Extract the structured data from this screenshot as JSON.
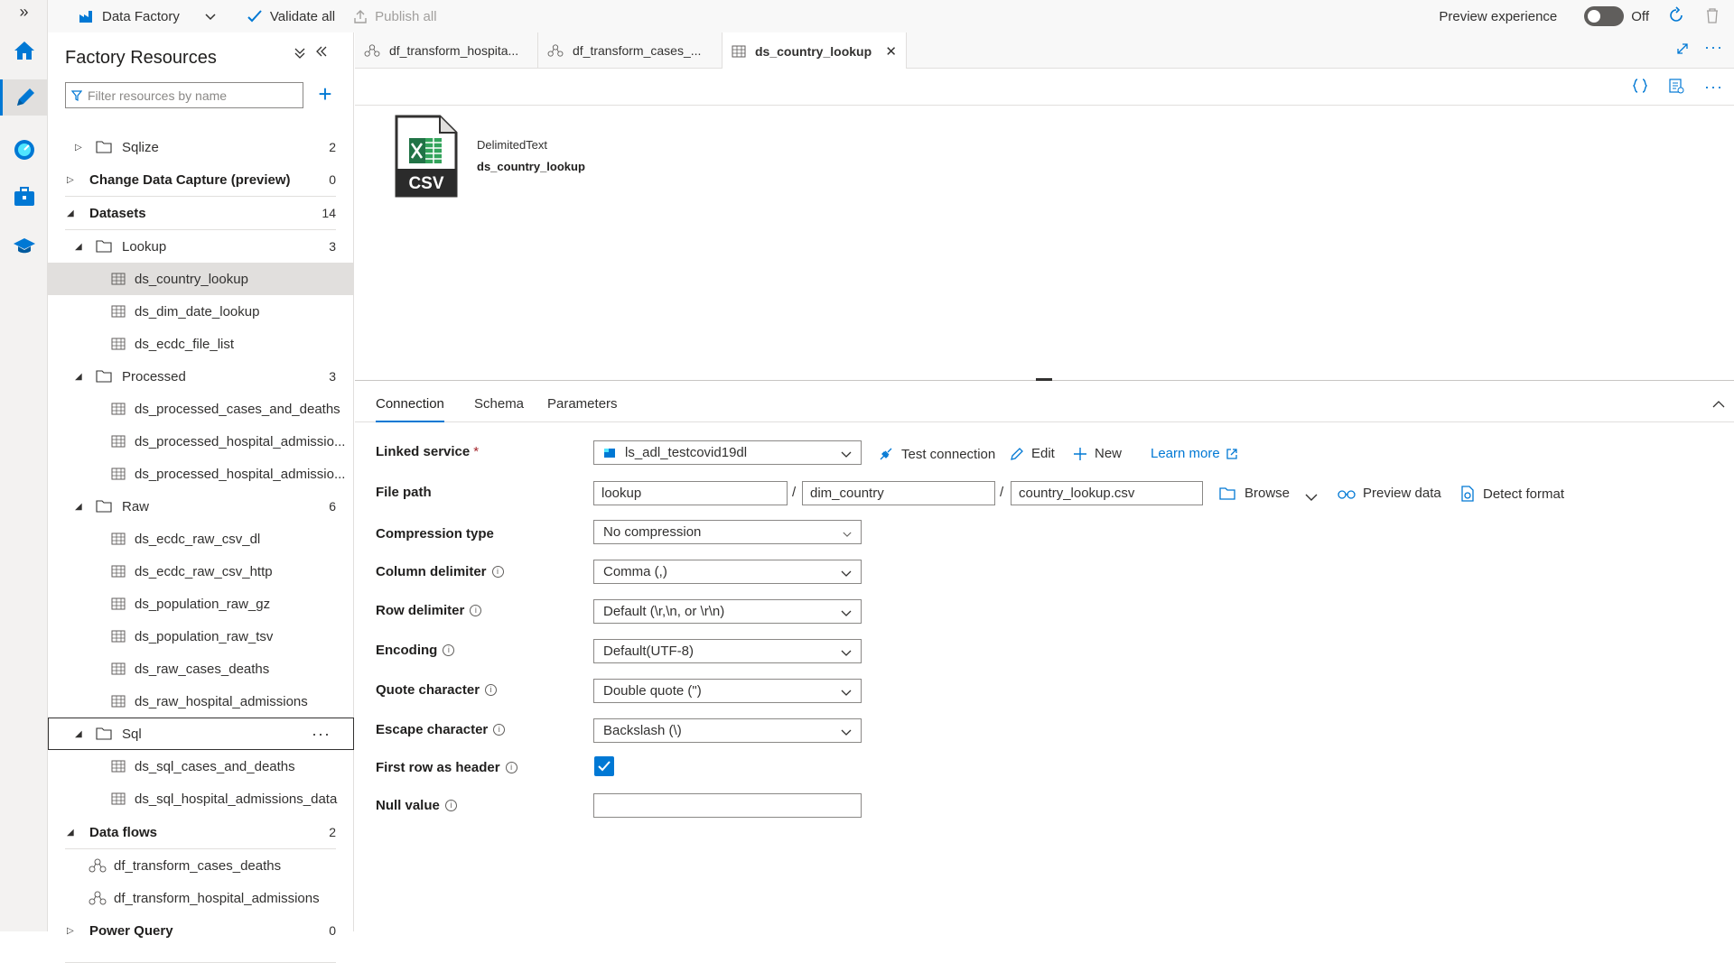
{
  "toolbar": {
    "factory_name": "Data Factory",
    "validate_all": "Validate all",
    "publish_all": "Publish all",
    "preview_experience": "Preview experience",
    "toggle_state": "Off"
  },
  "panel": {
    "title": "Factory Resources",
    "filter_placeholder": "Filter resources by name",
    "tree": {
      "sqlize": {
        "label": "Sqlize",
        "count": "2"
      },
      "cdc": {
        "label": "Change Data Capture (preview)",
        "count": "0"
      },
      "datasets": {
        "label": "Datasets",
        "count": "14"
      },
      "lookup": {
        "label": "Lookup",
        "count": "3"
      },
      "lookup_items": [
        "ds_country_lookup",
        "ds_dim_date_lookup",
        "ds_ecdc_file_list"
      ],
      "processed": {
        "label": "Processed",
        "count": "3"
      },
      "processed_items": [
        "ds_processed_cases_and_deaths",
        "ds_processed_hospital_admissio...",
        "ds_processed_hospital_admissio..."
      ],
      "raw": {
        "label": "Raw",
        "count": "6"
      },
      "raw_items": [
        "ds_ecdc_raw_csv_dl",
        "ds_ecdc_raw_csv_http",
        "ds_population_raw_gz",
        "ds_population_raw_tsv",
        "ds_raw_cases_deaths",
        "ds_raw_hospital_admissions"
      ],
      "sql": {
        "label": "Sql"
      },
      "sql_items": [
        "ds_sql_cases_and_deaths",
        "ds_sql_hospital_admissions_data"
      ],
      "dataflows": {
        "label": "Data flows",
        "count": "2"
      },
      "dataflow_items": [
        "df_transform_cases_deaths",
        "df_transform_hospital_admissions"
      ],
      "powerquery": {
        "label": "Power Query",
        "count": "0"
      }
    }
  },
  "tabs": [
    {
      "label": "df_transform_hospita..."
    },
    {
      "label": "df_transform_cases_..."
    },
    {
      "label": "ds_country_lookup"
    }
  ],
  "dataset": {
    "type": "DelimitedText",
    "name": "ds_country_lookup",
    "icon_text": "CSV"
  },
  "config": {
    "tabs": [
      "Connection",
      "Schema",
      "Parameters"
    ],
    "linked_service": {
      "label": "Linked service",
      "required": "*",
      "value": "ls_adl_testcovid19dl"
    },
    "actions": {
      "test_connection": "Test connection",
      "edit": "Edit",
      "new": "New",
      "learn_more": "Learn more"
    },
    "file_path": {
      "label": "File path",
      "container": "lookup",
      "directory": "dim_country",
      "file": "country_lookup.csv",
      "separator": "/"
    },
    "file_actions": {
      "browse": "Browse",
      "preview_data": "Preview data",
      "detect_format": "Detect format"
    },
    "compression": {
      "label": "Compression type",
      "value": "No compression"
    },
    "column_delimiter": {
      "label": "Column delimiter",
      "value": "Comma (,)"
    },
    "row_delimiter": {
      "label": "Row delimiter",
      "value": "Default (\\r,\\n, or \\r\\n)"
    },
    "encoding": {
      "label": "Encoding",
      "value": "Default(UTF-8)"
    },
    "quote_char": {
      "label": "Quote character",
      "value": "Double quote (\")"
    },
    "escape_char": {
      "label": "Escape character",
      "value": "Backslash (\\)"
    },
    "first_row_header": {
      "label": "First row as header",
      "checked": true
    },
    "null_value": {
      "label": "Null value",
      "value": ""
    }
  },
  "colors": {
    "accent": "#0078d4",
    "icon_blue": "#0078d4",
    "excel_green": "#217346"
  }
}
